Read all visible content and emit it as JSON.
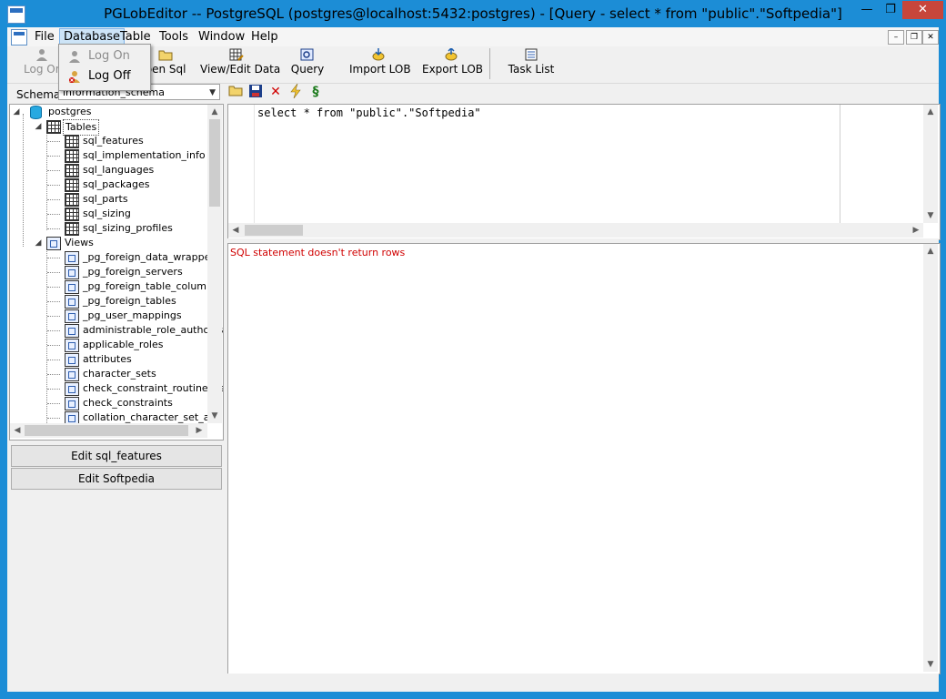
{
  "window": {
    "title": "PGLobEditor -- PostgreSQL (postgres@localhost:5432:postgres) - [Query - select * from \"public\".\"Softpedia\"]",
    "minimize_glyph": "—",
    "maximize_glyph": "❐",
    "close_glyph": "✕"
  },
  "menu": {
    "items": [
      "File",
      "Database",
      "Table",
      "Tools",
      "Window",
      "Help"
    ],
    "active": "Database",
    "mdi_minimize": "–",
    "mdi_restore": "❐",
    "mdi_close": "✕"
  },
  "database_menu": {
    "items": [
      {
        "label": "Log On",
        "enabled": false,
        "icon": "user-icon"
      },
      {
        "label": "Log Off",
        "enabled": true,
        "icon": "user-logoff-icon"
      }
    ]
  },
  "toolbar": {
    "buttons": [
      {
        "label": "Log On",
        "visible_text": "Log On",
        "icon": "user-icon",
        "enabled": false
      },
      {
        "label": "Open Sql",
        "visible_text": "pen Sql",
        "icon": "folder-icon",
        "enabled": true
      },
      {
        "label": "View/Edit Data",
        "icon": "grid-edit-icon",
        "enabled": true
      },
      {
        "label": "Query",
        "icon": "query-icon",
        "enabled": true
      },
      {
        "label": "Import LOB",
        "icon": "import-icon",
        "enabled": true
      },
      {
        "label": "Export LOB",
        "icon": "export-icon",
        "enabled": true
      },
      {
        "label": "Task List",
        "icon": "task-list-icon",
        "enabled": true
      }
    ]
  },
  "schema": {
    "label": "Schema",
    "selected": "information_schema"
  },
  "query_toolbar": [
    "open-icon",
    "save-icon",
    "delete-icon",
    "execute-icon",
    "format-icon"
  ],
  "tree": {
    "root": "postgres",
    "tables_label": "Tables",
    "tables": [
      "sql_features",
      "sql_implementation_info",
      "sql_languages",
      "sql_packages",
      "sql_parts",
      "sql_sizing",
      "sql_sizing_profiles"
    ],
    "views_label": "Views",
    "views": [
      "_pg_foreign_data_wrappers",
      "_pg_foreign_servers",
      "_pg_foreign_table_columns",
      "_pg_foreign_tables",
      "_pg_user_mappings",
      "administrable_role_authoriza",
      "applicable_roles",
      "attributes",
      "character_sets",
      "check_constraint_routine_us",
      "check_constraints",
      "collation_character_set_app"
    ]
  },
  "actions": {
    "edit_sql_features": "Edit sql_features",
    "edit_softpedia": "Edit Softpedia"
  },
  "editor": {
    "sql": "select * from \"public\".\"Softpedia\""
  },
  "results": {
    "message": "SQL statement doesn't return rows"
  },
  "colors": {
    "title_bar": "#1c8dd6",
    "error_text": "#d00000",
    "close_button": "#c7463b"
  }
}
